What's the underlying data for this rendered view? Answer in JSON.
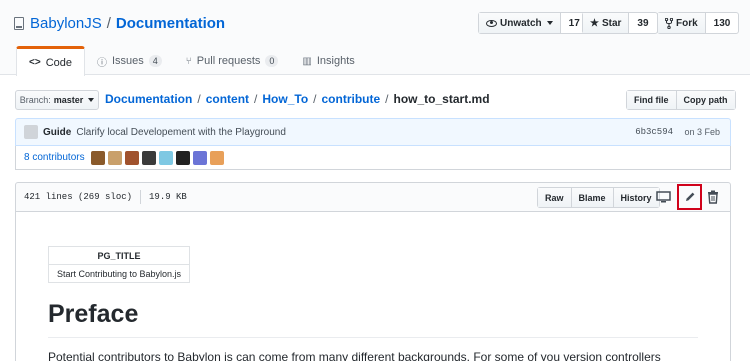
{
  "repo": {
    "owner": "BabylonJS",
    "separator": "/",
    "name": "Documentation"
  },
  "actions": {
    "watch": {
      "label": "Unwatch",
      "count": "17"
    },
    "star": {
      "label": "Star",
      "count": "39"
    },
    "fork": {
      "label": "Fork",
      "count": "130"
    }
  },
  "tabs": [
    {
      "label": "Code"
    },
    {
      "label": "Issues",
      "count": "4"
    },
    {
      "label": "Pull requests",
      "count": "0"
    },
    {
      "label": "Insights"
    }
  ],
  "branch": {
    "prefix": "Branch:",
    "name": "master"
  },
  "breadcrumb": [
    "Documentation",
    "content",
    "How_To",
    "contribute"
  ],
  "breadcrumb_file": "how_to_start.md",
  "file_actions": {
    "find": "Find file",
    "copy": "Copy path"
  },
  "commit": {
    "author": "Guide",
    "message": "Clarify local Developement with the Playground",
    "sha": "6b3c594",
    "date": "on 3 Feb"
  },
  "contributors": {
    "label": "8 contributors"
  },
  "file_info": {
    "lines": "421 lines (269 sloc)",
    "size": "19.9 KB"
  },
  "file_buttons": {
    "raw": "Raw",
    "blame": "Blame",
    "history": "History"
  },
  "content": {
    "table_header": "PG_TITLE",
    "table_value": "Start Contributing to Babylon.js",
    "heading": "Preface",
    "paragraph": "Potential contributors to Babylon is can come from many different backgrounds. For some of you version controllers"
  },
  "colors": {
    "accent_tab": "#e36209",
    "link": "#0366d6",
    "highlight": "#d0021b"
  }
}
